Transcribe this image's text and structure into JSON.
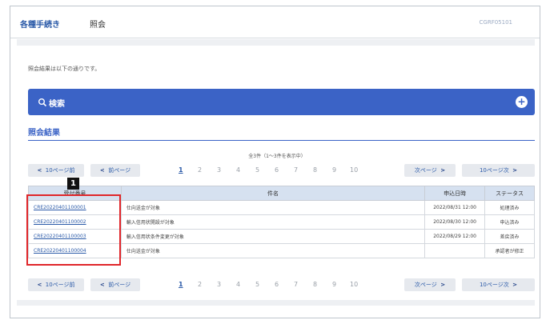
{
  "header": {
    "breadcrumb": "各種手続き",
    "title": "照会",
    "screen_id": "CGRF05101"
  },
  "intro_text": "照会結果は以下の通りです。",
  "search": {
    "label": "検索",
    "expand_symbol": "+"
  },
  "results": {
    "section_title": "照会結果",
    "count_text": "全3件（1〜3件を表示中）",
    "pager": {
      "prev10": "10ページ前",
      "prev": "前ページ",
      "next": "次ページ",
      "next10": "10ページ次",
      "prev_arrow": "<",
      "next_arrow": ">",
      "pages": [
        "1",
        "2",
        "3",
        "4",
        "5",
        "6",
        "7",
        "8",
        "9",
        "10"
      ],
      "current_page": "1"
    },
    "columns": [
      "受付番号",
      "件名",
      "申込日時",
      "ステータス"
    ],
    "rows": [
      {
        "id": "CRE20220401100001",
        "subject": "仕向送金が対象",
        "date": "2022/08/31 12:00",
        "status": "処理済み"
      },
      {
        "id": "CRE20220401100002",
        "subject": "輸入信用状開設が対象",
        "date": "2022/08/30 12:00",
        "status": "申込済み"
      },
      {
        "id": "CRE20220401100003",
        "subject": "輸入信用状条件変更が対象",
        "date": "2022/08/29 12:00",
        "status": "差戻済み"
      },
      {
        "id": "CRE20220401100004",
        "subject": "仕向送金が対象",
        "date": "",
        "status": "承認者が修正"
      }
    ]
  },
  "annotation": {
    "badge": "1"
  },
  "colors": {
    "accent": "#3b63c6",
    "link": "#2b5aa8",
    "callout": "#e0262a"
  }
}
